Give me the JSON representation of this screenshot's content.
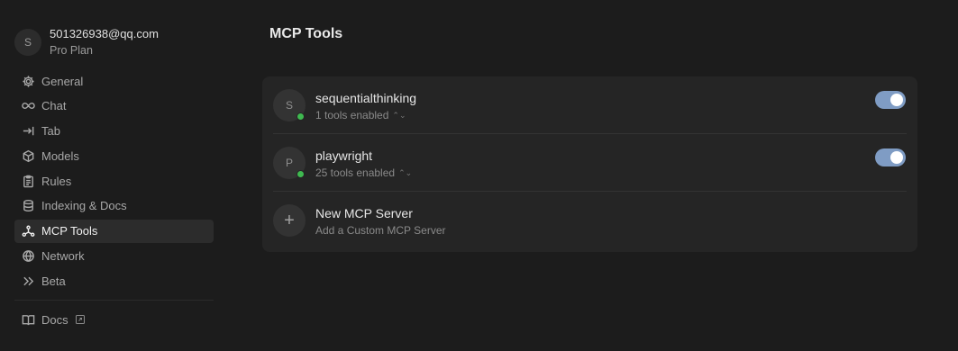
{
  "account": {
    "initial": "S",
    "email": "501326938@qq.com",
    "plan": "Pro Plan"
  },
  "nav": [
    {
      "label": "General",
      "icon": "gear-icon"
    },
    {
      "label": "Chat",
      "icon": "infinity-icon"
    },
    {
      "label": "Tab",
      "icon": "arrow-right-to-line-icon"
    },
    {
      "label": "Models",
      "icon": "cube-icon"
    },
    {
      "label": "Rules",
      "icon": "clipboard-icon"
    },
    {
      "label": "Indexing & Docs",
      "icon": "database-icon"
    },
    {
      "label": "MCP Tools",
      "icon": "mcp-icon",
      "active": true
    },
    {
      "label": "Network",
      "icon": "globe-icon"
    },
    {
      "label": "Beta",
      "icon": "chevrons-right-icon"
    }
  ],
  "docs": {
    "label": "Docs",
    "icon": "book-icon"
  },
  "page": {
    "title": "MCP Tools"
  },
  "servers": [
    {
      "initial": "S",
      "name": "sequentialthinking",
      "tools": "1 tools enabled",
      "enabled": true,
      "status_color": "#3fb950"
    },
    {
      "initial": "P",
      "name": "playwright",
      "tools": "25 tools enabled",
      "enabled": true,
      "status_color": "#3fb950"
    }
  ],
  "add_server": {
    "title": "New MCP Server",
    "subtitle": "Add a Custom MCP Server"
  },
  "colors": {
    "accent": "#7f9cc4",
    "status_ok": "#3fb950",
    "background": "#1c1c1c",
    "panel": "#252525"
  }
}
